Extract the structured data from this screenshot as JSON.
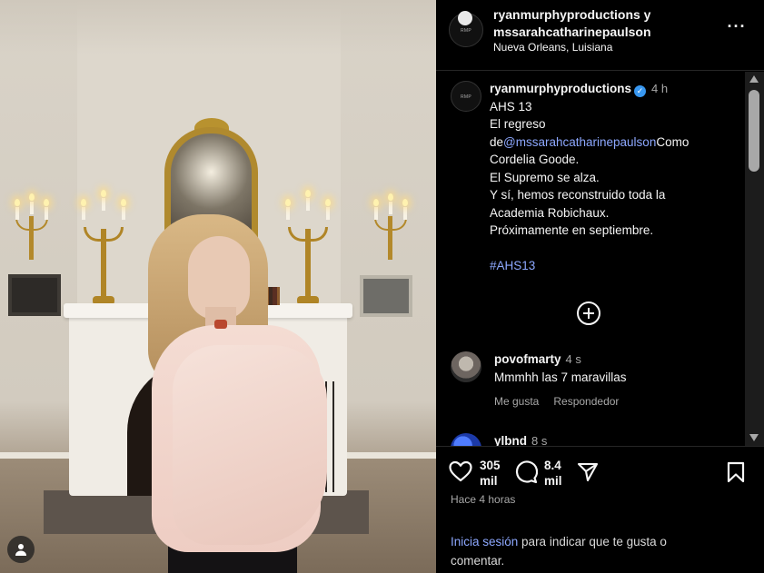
{
  "header": {
    "title": "ryanmurphyproductions y mssarahcatharinepaulson",
    "location": "Nueva Orleans, Luisiana",
    "more_icon": "more-horizontal-icon"
  },
  "caption": {
    "username": "ryanmurphyproductions",
    "verified_mark": "✓",
    "time": "4 h",
    "line1": "AHS 13",
    "line2": "El regreso",
    "line3_prefix": "de",
    "mention": "@mssarahcatharinepaulson",
    "line3_suffix": "Como",
    "line4": "Cordelia Goode.",
    "line5": "El Supremo se alza.",
    "line6": "Y sí, hemos reconstruido toda la",
    "line7": "Academia Robichaux.",
    "line8": "Próximamente en septiembre.",
    "hashtag": "#AHS13"
  },
  "comments": [
    {
      "username": "povofmarty",
      "time": "4 s",
      "text": "Mmmhh las 7 maravillas",
      "like_label": "Me gusta",
      "reply_label": "Respondedor"
    },
    {
      "username": "ylbnd",
      "time": "8 s"
    }
  ],
  "actions": {
    "likes_count": "305",
    "likes_unit": "mil",
    "comments_count": "8.4",
    "comments_unit": "mil",
    "posted": "Hace 4 horas"
  },
  "login": {
    "link": "Inicia sesión",
    "rest": " para indicar que te gusta o comentar."
  },
  "colors": {
    "accent_link": "#8da8ff",
    "verified": "#3897f0",
    "background": "#000000"
  }
}
